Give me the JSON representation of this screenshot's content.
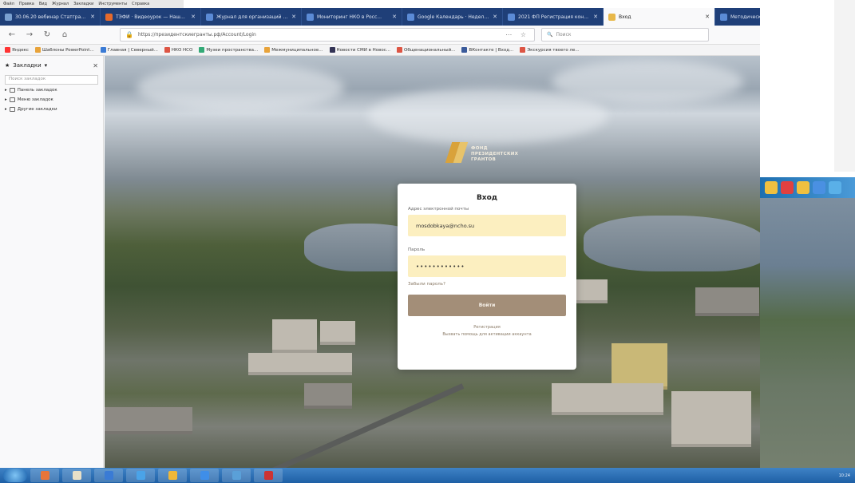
{
  "menubar": {
    "items": [
      "Файл",
      "Правка",
      "Вид",
      "Журнал",
      "Закладки",
      "Инструменты",
      "Справка"
    ]
  },
  "tabs": [
    {
      "title": "30.06.20 вебинар Статгранты",
      "color": "#7aa0d0"
    },
    {
      "title": "ТЭФИ · Видеоурок — Наши...",
      "color": "#e66a2c"
    },
    {
      "title": "Журнал для организаций конф...",
      "color": "#5b8bd6"
    },
    {
      "title": "Мониторинг НКО в Росс...",
      "color": "#5b8bd6"
    },
    {
      "title": "Google Календарь · Неделя...",
      "color": "#5b8bd6"
    },
    {
      "title": "2021 ФП Регистрация конфер...",
      "color": "#5b8bd6"
    },
    {
      "title": "Вход",
      "color": "#e8b84a",
      "active": true
    },
    {
      "title": "Методическое сопровождение...",
      "color": "#5b8bd6"
    }
  ],
  "nav": {
    "url": "https://президентскиегранты.рф/Account/Login",
    "search_placeholder": "Поиск"
  },
  "bookmarks": [
    {
      "label": "Яндекс",
      "color": "#f33"
    },
    {
      "label": "Шаблоны PowerPoint...",
      "color": "#e8a33a"
    },
    {
      "label": "Главная | Северный...",
      "color": "#3a7bd5"
    },
    {
      "label": "НКО НСО",
      "color": "#d54"
    },
    {
      "label": "Музеи пространства...",
      "color": "#3a7"
    },
    {
      "label": "Межмуниципальное...",
      "color": "#e8a33a"
    },
    {
      "label": "Новости СМИ в Новос...",
      "color": "#335"
    },
    {
      "label": "Общенациональный...",
      "color": "#d54"
    },
    {
      "label": "ВКонтакте | Вход...",
      "color": "#3a5a9a"
    },
    {
      "label": "Экскурсия твоего ле...",
      "color": "#d54"
    }
  ],
  "sidebar": {
    "title": "Закладки",
    "search_placeholder": "Поиск закладок",
    "items": [
      {
        "label": "Панель закладок"
      },
      {
        "label": "Меню закладок"
      },
      {
        "label": "Другие закладки"
      }
    ]
  },
  "logo": {
    "line1": "ФОНД",
    "line2": "ПРЕЗИДЕНТСКИХ",
    "line3": "ГРАНТОВ"
  },
  "login": {
    "title": "Вход",
    "email_label": "Адрес электронной почты",
    "email_value": "mosdobkaya@ncho.su",
    "password_label": "Пароль",
    "password_value": "••••••••••••",
    "forgot_link": "Забыли пароль?",
    "submit_label": "Войти",
    "register_link": "Регистрация",
    "extra_link": "Вызвать помощь для активации аккаунта"
  },
  "taskbar": {
    "apps": [
      "#e8753a",
      "#e8e0c8",
      "#3a7bd5",
      "#4aa3e8",
      "#f0b838",
      "#3f8ee8",
      "#5aa0d8",
      "#c33"
    ],
    "tray_time": "10:24"
  }
}
